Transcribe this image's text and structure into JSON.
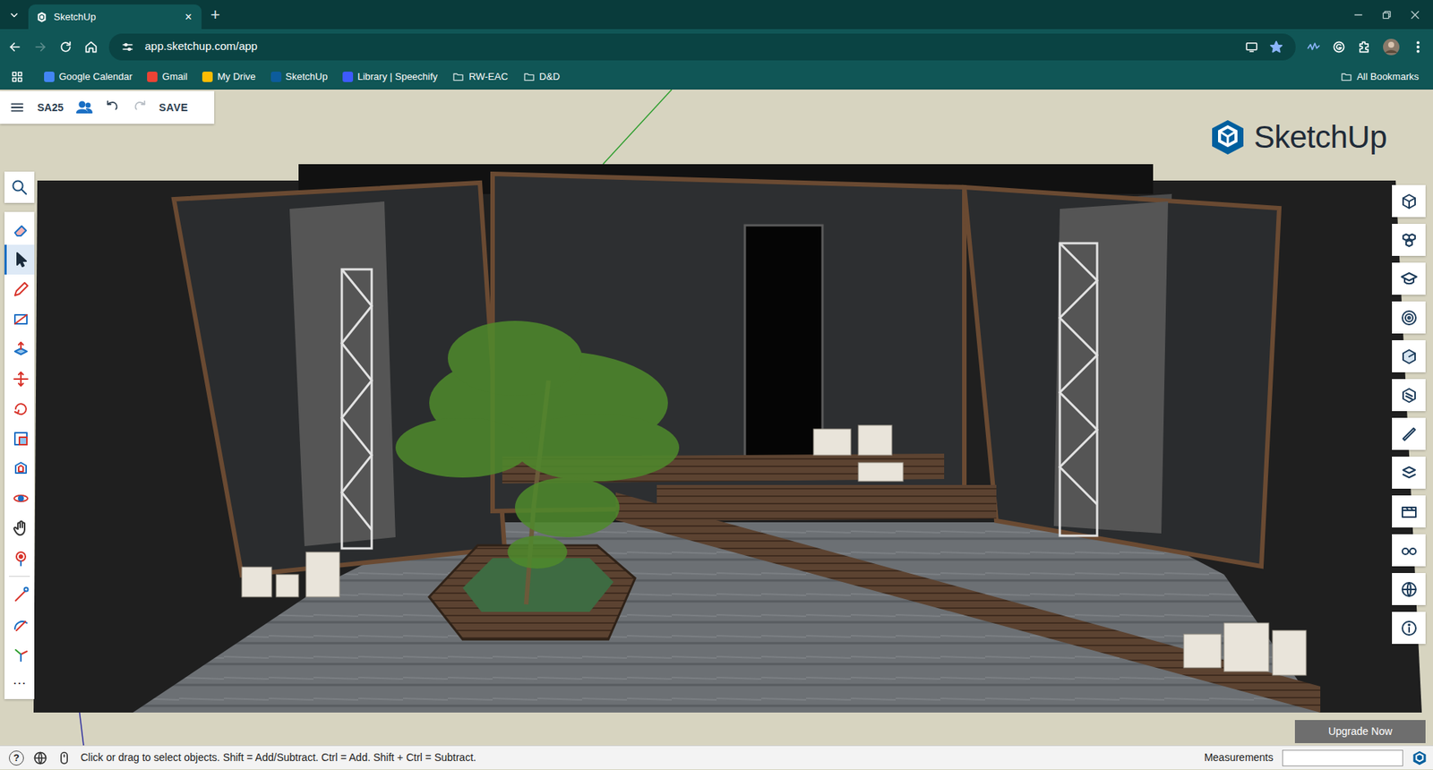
{
  "browser": {
    "tabs": [
      {
        "label": "SketchUp",
        "selected": true,
        "close": "×"
      }
    ],
    "new_tab": "+",
    "forward_disabled": true,
    "address": "app.sketchup.com/app",
    "bookmarks": [
      {
        "label": "Google Calendar",
        "kind": "site",
        "color": "#4285f4"
      },
      {
        "label": "Gmail",
        "kind": "site",
        "color": "#ea4335"
      },
      {
        "label": "My Drive",
        "kind": "site",
        "color": "#fbbc04"
      },
      {
        "label": "SketchUp",
        "kind": "site",
        "color": "#0c5c9c"
      },
      {
        "label": "Library | Speechify",
        "kind": "site",
        "color": "#3d5afe"
      },
      {
        "label": "RW-EAC",
        "kind": "folder"
      },
      {
        "label": "D&D",
        "kind": "folder"
      }
    ],
    "all_bookmarks": "All Bookmarks"
  },
  "app": {
    "file_name": "SA25",
    "save": "SAVE",
    "redo_disabled": true,
    "logo": "SketchUp",
    "left_tools": [
      {
        "selected": false
      },
      {
        "selected": true
      },
      {
        "selected": false
      },
      {
        "selected": false
      },
      {
        "selected": false
      },
      {
        "selected": false
      },
      {
        "selected": false
      },
      {
        "selected": false
      },
      {
        "selected": false
      },
      {
        "selected": false
      },
      {
        "selected": false
      },
      {
        "selected": false
      },
      {
        "selected": false
      },
      {
        "selected": false
      },
      {
        "selected": false
      }
    ],
    "more_tools": "⋯",
    "upgrade": "Upgrade Now"
  },
  "status_bar": {
    "help": "?",
    "text": "Click or drag to select objects. Shift = Add/Subtract. Ctrl = Add. Shift + Ctrl = Subtract.",
    "measurements_label": "Measurements",
    "measurements_value": ""
  }
}
